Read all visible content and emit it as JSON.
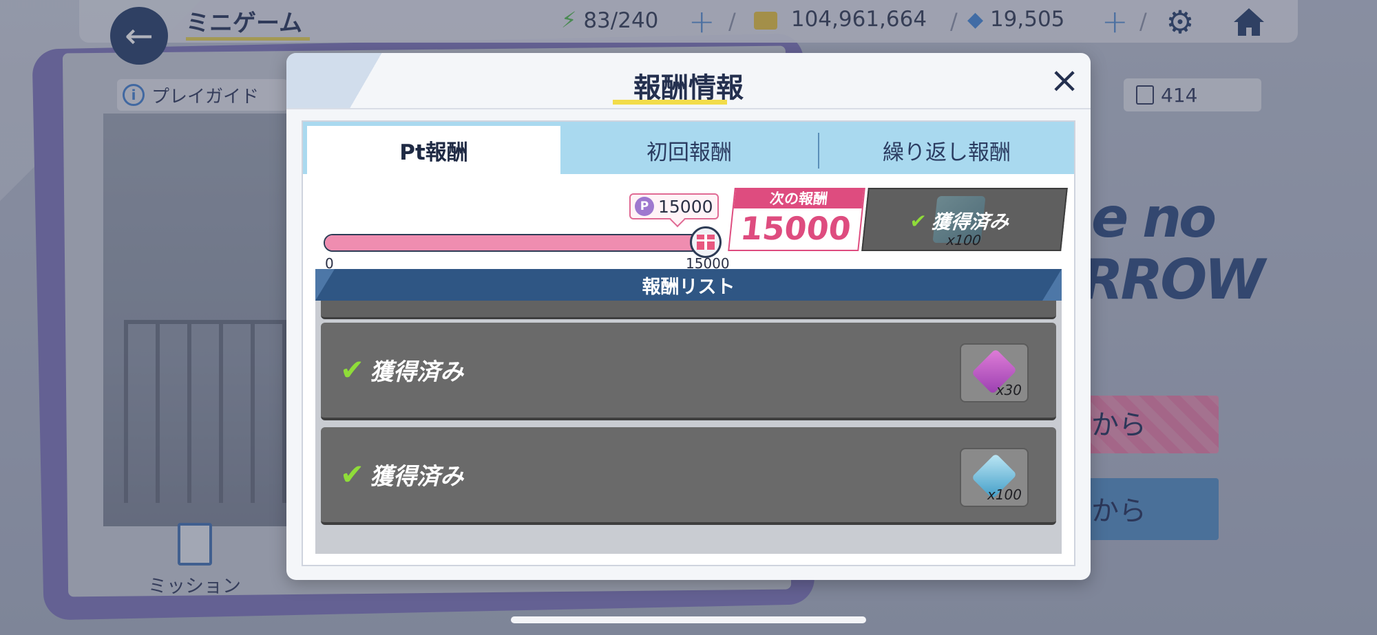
{
  "header": {
    "back_label": "←",
    "title": "ミニゲーム",
    "stamina": "83/240",
    "coins": "104,961,664",
    "crystals": "19,505",
    "plus": "+"
  },
  "background": {
    "guide_label": "プレイガイド",
    "info_glyph": "i",
    "counter_value": "414",
    "mission_label": "ミッション",
    "side_button_1": "から",
    "side_button_2": "から",
    "deco_text_1": "e no",
    "deco_text_2": "RROW"
  },
  "modal": {
    "title": "報酬情報",
    "close": "×",
    "tabs": [
      {
        "label": "Pt報酬",
        "active": true
      },
      {
        "label": "初回報酬",
        "active": false
      },
      {
        "label": "繰り返し報酬",
        "active": false
      }
    ],
    "progress": {
      "bubble_icon": "P",
      "bubble_value": "15000",
      "min_label": "0",
      "max_label": "15000",
      "fraction": 1.0
    },
    "next_reward": {
      "label": "次の報酬",
      "value": "15000",
      "status": "獲得済み",
      "quantity": "x100"
    },
    "list_header": "報酬リスト",
    "rows": [
      {
        "status": "獲得済み",
        "quantity": "x30",
        "icon": "purple-gem-icon"
      },
      {
        "status": "獲得済み",
        "quantity": "x100",
        "icon": "blue-crystal-icon"
      }
    ],
    "check": "✔"
  },
  "colors": {
    "accent_pink": "#de4c7f",
    "progress_fill": "#ef8db0",
    "tab_bg": "#a9d9ef",
    "list_header": "#2f5684",
    "check_green": "#8fdc39"
  }
}
